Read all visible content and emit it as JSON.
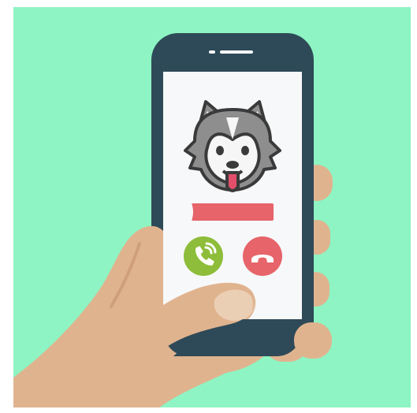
{
  "illustration": {
    "description_icons": [
      "phone-icon",
      "husky-avatar-icon",
      "accept-call-icon",
      "decline-call-icon",
      "hand-icon"
    ],
    "colors": {
      "background": "#8ef4c3",
      "phone_body": "#2e4a58",
      "screen": "#f7f8f9",
      "skin": "#e0b38f",
      "skin_shadow": "#cf9f7b",
      "accept": "#8dbd3a",
      "decline": "#e6646a",
      "name_bar": "#e6646a",
      "dog_fur": "#8e8e8e",
      "dog_face": "#f6f6f6",
      "dog_outline": "#3a3a3a",
      "tongue": "#e24f6b"
    },
    "caller_name": "",
    "speaker_visible": true
  }
}
